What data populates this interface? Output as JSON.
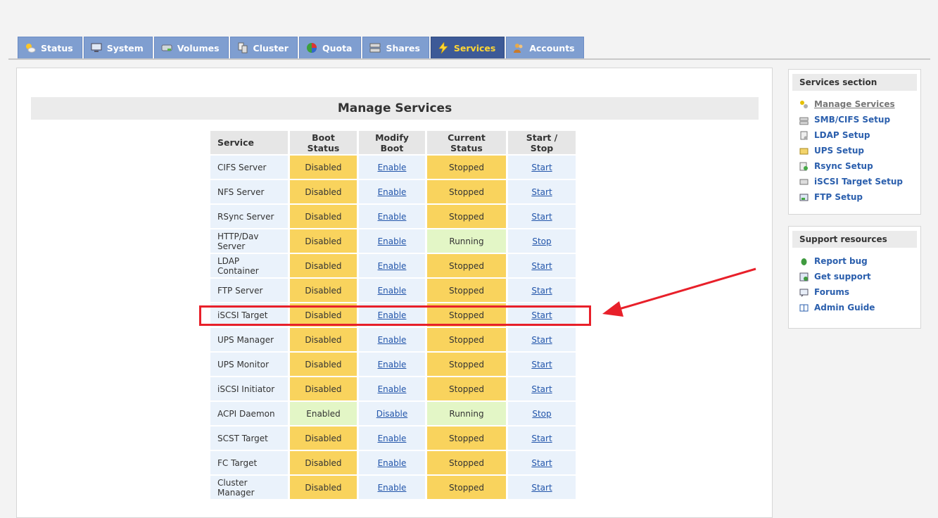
{
  "tabs": [
    {
      "label": "Status",
      "icon": "sun-cloud-icon"
    },
    {
      "label": "System",
      "icon": "monitor-icon"
    },
    {
      "label": "Volumes",
      "icon": "drive-icon"
    },
    {
      "label": "Cluster",
      "icon": "cluster-icon"
    },
    {
      "label": "Quota",
      "icon": "pie-icon"
    },
    {
      "label": "Shares",
      "icon": "server-icon"
    },
    {
      "label": "Services",
      "icon": "lightning-icon",
      "active": true
    },
    {
      "label": "Accounts",
      "icon": "users-icon"
    }
  ],
  "main": {
    "title": "Manage Services",
    "columns": [
      "Service",
      "Boot Status",
      "Modify Boot",
      "Current Status",
      "Start / Stop"
    ],
    "rows": [
      {
        "service": "CIFS Server",
        "boot": "Disabled",
        "modify": "Enable",
        "current": "Stopped",
        "action": "Start"
      },
      {
        "service": "NFS Server",
        "boot": "Disabled",
        "modify": "Enable",
        "current": "Stopped",
        "action": "Start"
      },
      {
        "service": "RSync Server",
        "boot": "Disabled",
        "modify": "Enable",
        "current": "Stopped",
        "action": "Start"
      },
      {
        "service": "HTTP/Dav Server",
        "boot": "Disabled",
        "modify": "Enable",
        "current": "Running",
        "action": "Stop"
      },
      {
        "service": "LDAP Container",
        "boot": "Disabled",
        "modify": "Enable",
        "current": "Stopped",
        "action": "Start"
      },
      {
        "service": "FTP Server",
        "boot": "Disabled",
        "modify": "Enable",
        "current": "Stopped",
        "action": "Start"
      },
      {
        "service": "iSCSI Target",
        "boot": "Disabled",
        "modify": "Enable",
        "current": "Stopped",
        "action": "Start"
      },
      {
        "service": "UPS Manager",
        "boot": "Disabled",
        "modify": "Enable",
        "current": "Stopped",
        "action": "Start"
      },
      {
        "service": "UPS Monitor",
        "boot": "Disabled",
        "modify": "Enable",
        "current": "Stopped",
        "action": "Start"
      },
      {
        "service": "iSCSI Initiator",
        "boot": "Disabled",
        "modify": "Enable",
        "current": "Stopped",
        "action": "Start"
      },
      {
        "service": "ACPI Daemon",
        "boot": "Enabled",
        "modify": "Disable",
        "current": "Running",
        "action": "Stop"
      },
      {
        "service": "SCST Target",
        "boot": "Disabled",
        "modify": "Enable",
        "current": "Stopped",
        "action": "Start"
      },
      {
        "service": "FC Target",
        "boot": "Disabled",
        "modify": "Enable",
        "current": "Stopped",
        "action": "Start"
      },
      {
        "service": "Cluster Manager",
        "boot": "Disabled",
        "modify": "Enable",
        "current": "Stopped",
        "action": "Start"
      }
    ]
  },
  "services_section": {
    "title": "Services section",
    "items": [
      {
        "label": "Manage Services",
        "icon": "services-icon",
        "current": true
      },
      {
        "label": "SMB/CIFS Setup",
        "icon": "server-icon"
      },
      {
        "label": "LDAP Setup",
        "icon": "ldap-icon"
      },
      {
        "label": "UPS Setup",
        "icon": "ups-icon"
      },
      {
        "label": "Rsync Setup",
        "icon": "rsync-icon"
      },
      {
        "label": "iSCSI Target Setup",
        "icon": "iscsi-icon"
      },
      {
        "label": "FTP Setup",
        "icon": "ftp-icon"
      }
    ]
  },
  "support_resources": {
    "title": "Support resources",
    "items": [
      {
        "label": "Report bug",
        "icon": "bug-icon"
      },
      {
        "label": "Get support",
        "icon": "support-icon"
      },
      {
        "label": "Forums",
        "icon": "forums-icon"
      },
      {
        "label": "Admin Guide",
        "icon": "book-icon"
      }
    ]
  },
  "colors": {
    "tab": "#7f9ed0",
    "tab_active": "#3d5a97",
    "status_warn": "#f9d35d",
    "status_ok": "#e3f6c6",
    "highlight": "#e8202a",
    "link": "#2255aa"
  }
}
